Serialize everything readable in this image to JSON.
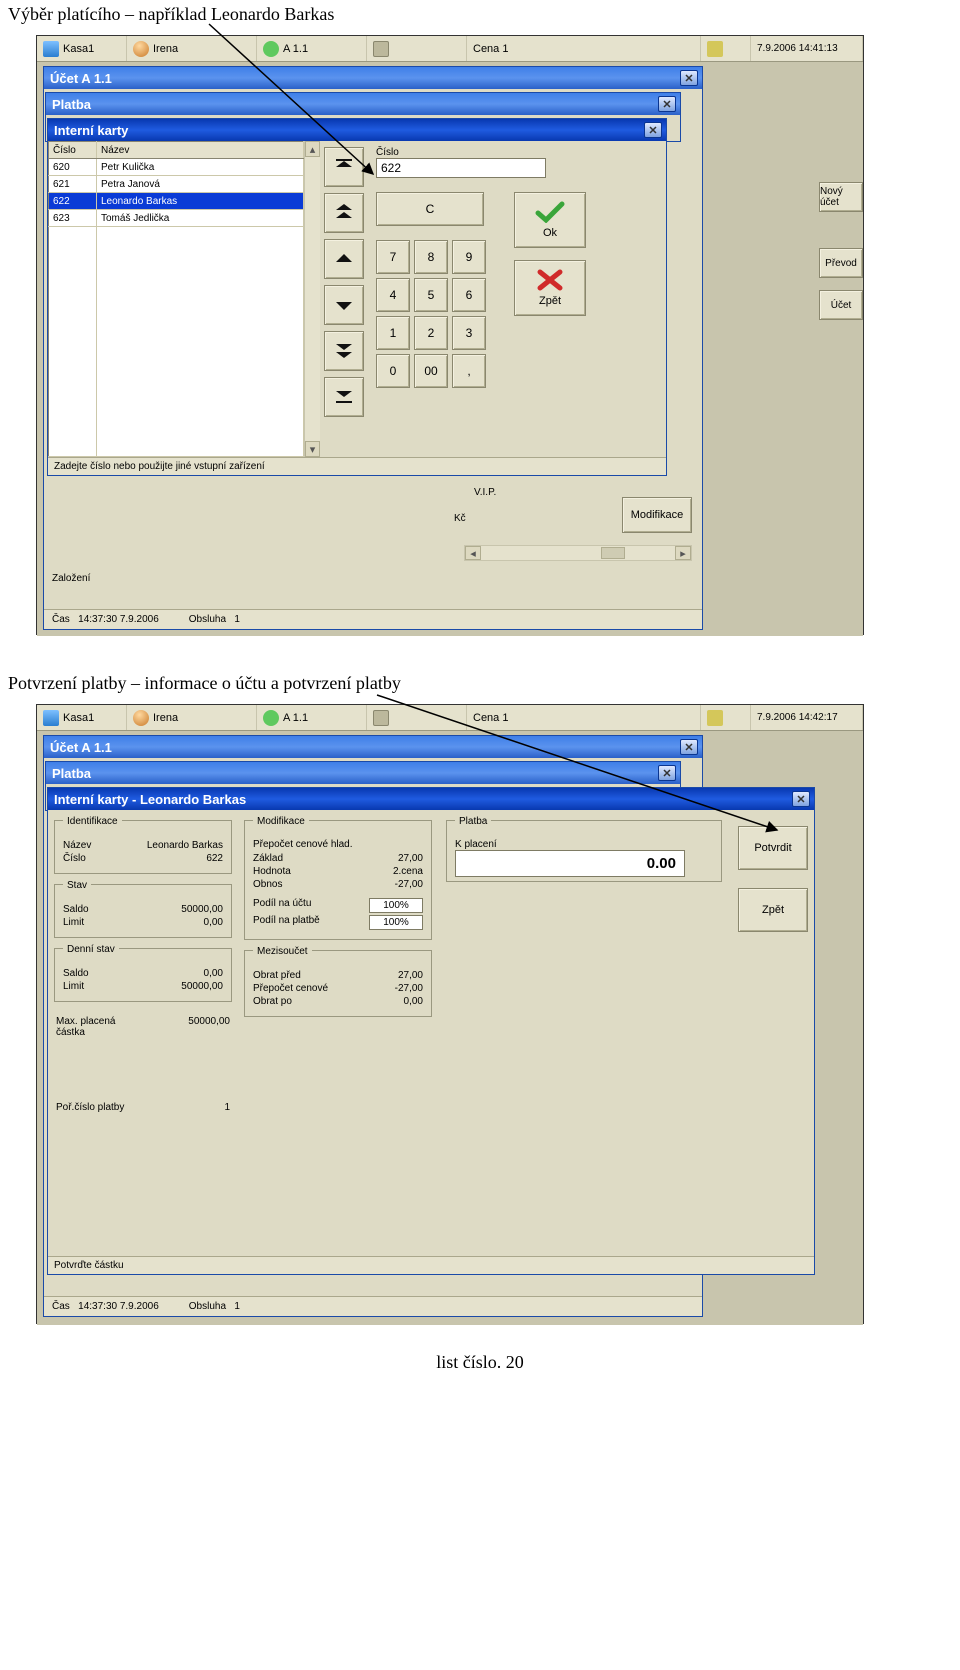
{
  "caption1": "Výběr platícího – například Leonardo Barkas",
  "caption2": "Potvrzení platby – informace o účtu a potvrzení platby",
  "footer": "list číslo.  20",
  "statusbar": {
    "kasa": "Kasa1",
    "user": "Irena",
    "room": "A 1.1",
    "cena": "Cena 1",
    "ts1": "7.9.2006 14:41:13",
    "ts2": "7.9.2006 14:42:17"
  },
  "shot1": {
    "win_ucet": "Účet A 1.1",
    "win_platba": "Platba",
    "win_karty": "Interní karty",
    "col_cislo": "Číslo",
    "col_nazev": "Název",
    "rows": [
      {
        "c": "620",
        "n": "Petr Kulička"
      },
      {
        "c": "621",
        "n": "Petra Janová"
      },
      {
        "c": "622",
        "n": "Leonardo Barkas"
      },
      {
        "c": "623",
        "n": "Tomáš Jedlička"
      }
    ],
    "cislo_label": "Číslo",
    "cislo_value": "622",
    "key_c": "C",
    "key_0": "0",
    "key_00": "00",
    "key_dot": ",",
    "key_1": "1",
    "key_2": "2",
    "key_3": "3",
    "key_4": "4",
    "key_5": "5",
    "key_6": "6",
    "key_7": "7",
    "key_8": "8",
    "key_9": "9",
    "ok": "Ok",
    "zpet": "Zpět",
    "hint": "Zadejte číslo nebo použijte jiné vstupní zařízení",
    "behind_vip": "V.I.P.",
    "behind_kc": "Kč",
    "behind_mod": "Modifikace",
    "side_ucet": "Nový účet",
    "side_vod": "Převod",
    "side_hucet": "Účet",
    "zalozeni": "Založení",
    "info_cas_l": "Čas",
    "info_cas_v": "14:37:30   7.9.2006",
    "info_obs_l": "Obsluha",
    "info_obs_v": "1"
  },
  "shot2": {
    "win_ucet": "Účet A 1.1",
    "win_platba": "Platba",
    "win_karty": "Interní karty - Leonardo Barkas",
    "grp_ident": "Identifikace",
    "ident_nazev_l": "Název",
    "ident_nazev_v": "Leonardo Barkas",
    "ident_cislo_l": "Číslo",
    "ident_cislo_v": "622",
    "grp_stav": "Stav",
    "stav_saldo_l": "Saldo",
    "stav_saldo_v": "50000,00",
    "stav_limit_l": "Limit",
    "stav_limit_v": "0,00",
    "grp_denni": "Denní stav",
    "denni_saldo_l": "Saldo",
    "denni_saldo_v": "0,00",
    "denni_limit_l": "Limit",
    "denni_limit_v": "50000,00",
    "max_l": "Max. placená částka",
    "max_v": "50000,00",
    "por_l": "Poř.číslo platby",
    "por_v": "1",
    "grp_mod": "Modifikace",
    "mod_prepocet": "Přepočet cenové hlad.",
    "mod_zaklad_l": "Základ",
    "mod_zaklad_v": "27,00",
    "mod_hodnota_l": "Hodnota",
    "mod_hodnota_v": "2.cena",
    "mod_obnos_l": "Obnos",
    "mod_obnos_v": "-27,00",
    "mod_podilu_l": "Podíl na účtu",
    "mod_podilu_v": "100%",
    "mod_podilp_l": "Podíl na platbě",
    "mod_podilp_v": "100%",
    "grp_mezi": "Mezisoučet",
    "mezi_pred_l": "Obrat před",
    "mezi_pred_v": "27,00",
    "mezi_prep_l": "Přepočet cenové",
    "mezi_prep_v": "-27,00",
    "mezi_po_l": "Obrat po",
    "mezi_po_v": "0,00",
    "grp_platba": "Platba",
    "platba_kpl_l": "K placení",
    "platba_amount": "0.00",
    "btn_potvrdit": "Potvrdit",
    "btn_zpet": "Zpět",
    "hint": "Potvrďte částku",
    "info_cas_l": "Čas",
    "info_cas_v": "14:37:30   7.9.2006",
    "info_obs_l": "Obsluha",
    "info_obs_v": "1"
  }
}
